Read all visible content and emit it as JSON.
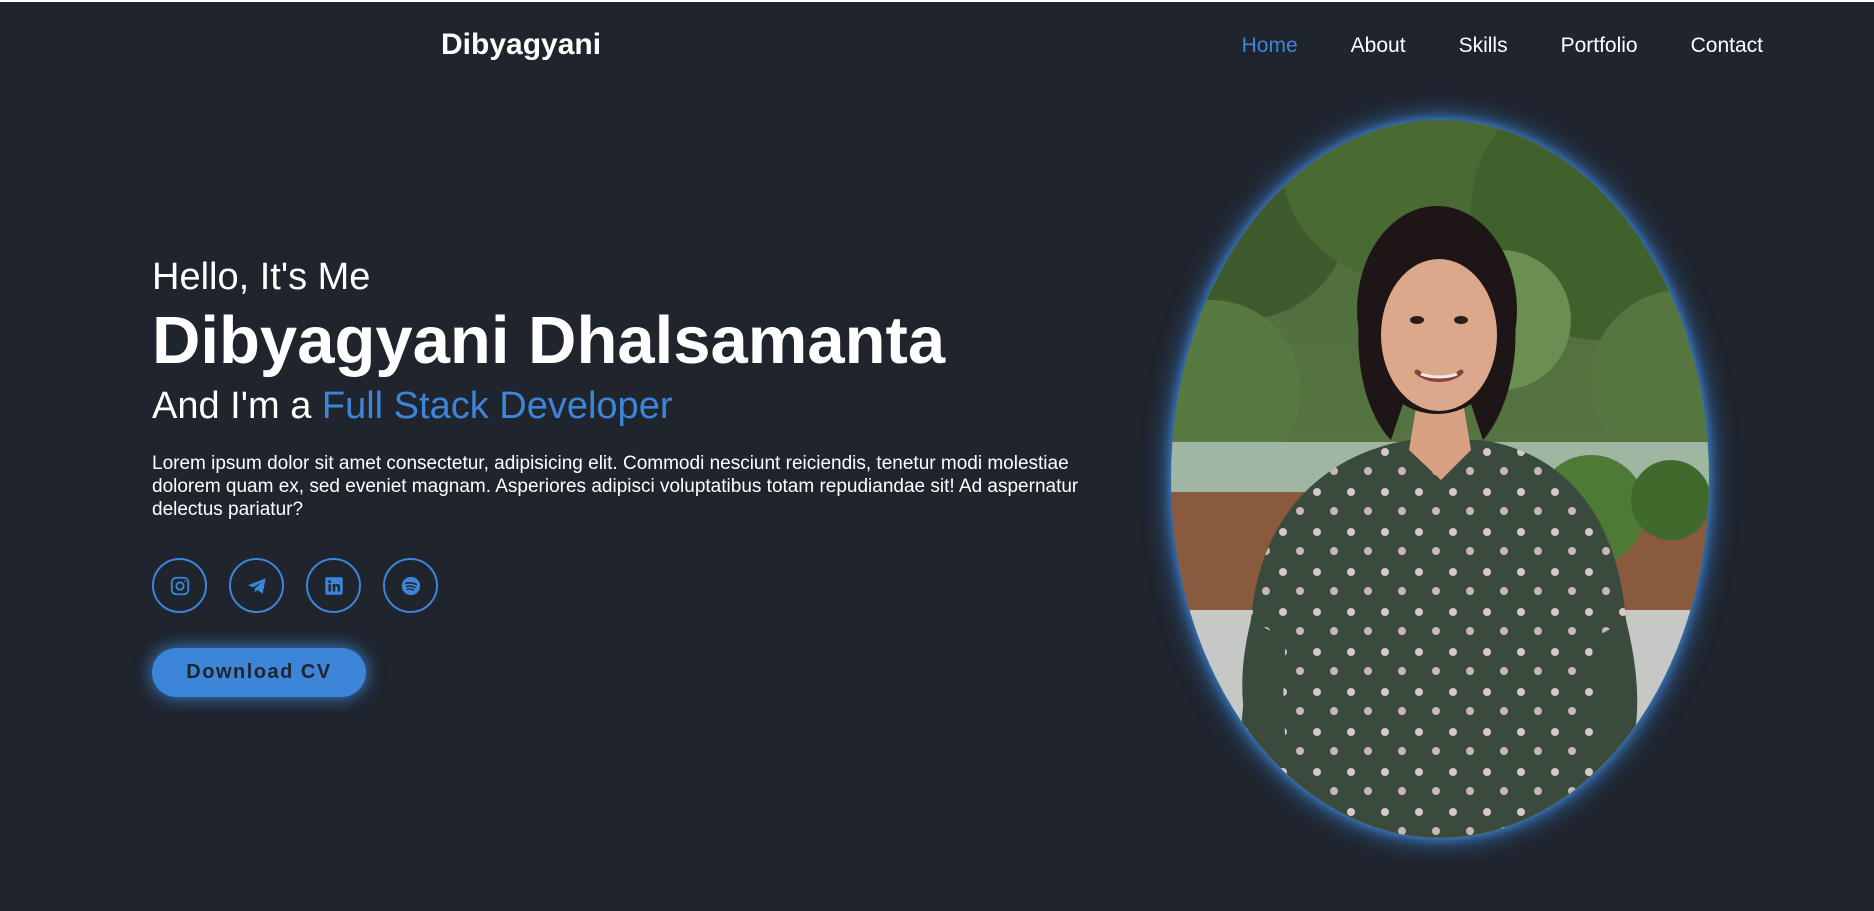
{
  "header": {
    "logo": "Dibyagyani",
    "nav": [
      {
        "label": "Home",
        "active": true
      },
      {
        "label": "About",
        "active": false
      },
      {
        "label": "Skills",
        "active": false
      },
      {
        "label": "Portfolio",
        "active": false
      },
      {
        "label": "Contact",
        "active": false
      }
    ]
  },
  "hero": {
    "greeting": "Hello, It's Me",
    "name": "Dibyagyani Dhalsamanta",
    "role_prefix": "And I'm a ",
    "role_highlight": "Full Stack Developer",
    "description": "Lorem ipsum dolor sit amet consectetur, adipisicing elit. Commodi nesciunt reiciendis, tenetur modi molestiae dolorem quam ex, sed eveniet magnam. Asperiores adipisci voluptatibus totam repudiandae sit! Ad aspernatur delectus pariatur?",
    "socials": [
      "instagram-icon",
      "telegram-icon",
      "linkedin-icon",
      "spotify-icon"
    ],
    "cta_label": "Download CV"
  },
  "colors": {
    "background": "#1f242d",
    "accent": "#3d85d8",
    "text": "#ffffff"
  }
}
